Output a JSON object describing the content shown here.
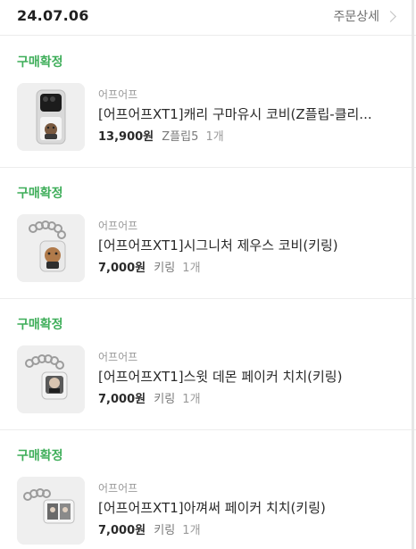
{
  "order": {
    "date": "24.07.06",
    "detail_label": "주문상세"
  },
  "items": [
    {
      "status": "구매확정",
      "brand": "어프어프",
      "name": "[어프어프XT1]캐리 구마유시 코비(Z플립-클리...",
      "price": "13,900원",
      "option": "Z플립5",
      "quantity": "1개"
    },
    {
      "status": "구매확정",
      "brand": "어프어프",
      "name": "[어프어프XT1]시그니처 제우스 코비(키링)",
      "price": "7,000원",
      "option": "키링",
      "quantity": "1개"
    },
    {
      "status": "구매확정",
      "brand": "어프어프",
      "name": "[어프어프XT1]스윗 데몬 페이커 치치(키링)",
      "price": "7,000원",
      "option": "키링",
      "quantity": "1개"
    },
    {
      "status": "구매확정",
      "brand": "어프어프",
      "name": "[어프어프XT1]아껴써 페이커 치치(키링)",
      "price": "7,000원",
      "option": "키링",
      "quantity": "1개"
    }
  ],
  "colors": {
    "status_green": "#3fae5a",
    "thumb_bg": "#efefef"
  }
}
